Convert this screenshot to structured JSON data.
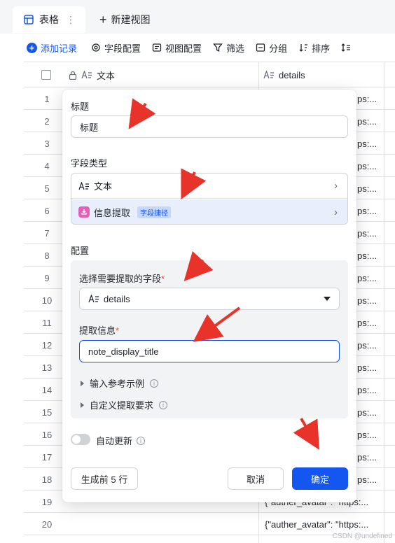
{
  "tabs": {
    "active_label": "表格",
    "more_glyph": "⋮",
    "new_view_label": "新建视图"
  },
  "toolbar": {
    "add_record": "添加记录",
    "field_config": "字段配置",
    "view_config": "视图配置",
    "filter": "筛选",
    "group": "分组",
    "sort": "排序"
  },
  "table": {
    "columns": [
      "文本",
      "details"
    ],
    "row_numbers": [
      "1",
      "2",
      "3",
      "4",
      "5",
      "6",
      "7",
      "8",
      "9",
      "10",
      "11",
      "12",
      "13",
      "14",
      "15",
      "16",
      "17",
      "18",
      "19",
      "20"
    ],
    "details_cells": [
      "ps:...",
      "ps:...",
      "ps:...",
      "ps:...",
      "ps:...",
      "ps:...",
      "ps:...",
      "ps:...",
      "ps:...",
      "ps:...",
      "ps:...",
      "ps:...",
      "ps:...",
      "ps:...",
      "ps:...",
      "ps:...",
      "ps:...",
      "ps:...",
      "{\"auther_avatar\": \"https:...",
      "{\"auther_avatar\": \"https:..."
    ]
  },
  "panel": {
    "title_label": "标题",
    "title_value": "标题",
    "field_type_label": "字段类型",
    "type_text": "文本",
    "type_extract": "信息提取",
    "type_extract_badge": "字段捷径",
    "config_label": "配置",
    "select_field_label": "选择需要提取的字段",
    "select_field_value": "details",
    "extract_info_label": "提取信息",
    "extract_info_value": "note_display_title",
    "example_label": "输入参考示例",
    "custom_label": "自定义提取要求",
    "auto_update_label": "自动更新",
    "generate_label": "生成前 5 行",
    "cancel_label": "取消",
    "confirm_label": "确定"
  },
  "watermark": "CSDN @undefined",
  "colors": {
    "accent": "#1456f0",
    "required": "#f54a45",
    "arrow": "#e8332b",
    "selected_row": "#e8eefc"
  }
}
